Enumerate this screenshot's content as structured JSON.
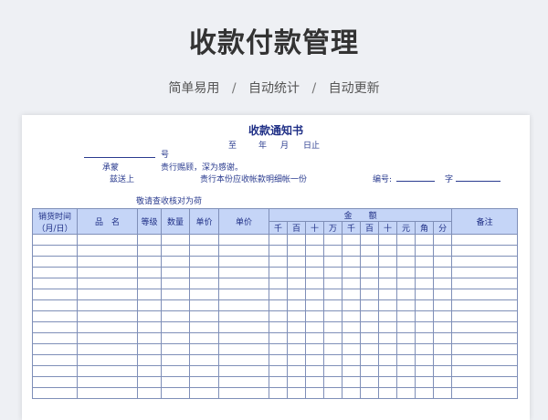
{
  "header": {
    "title": "收款付款管理",
    "features": [
      "简单易用",
      "自动统计",
      "自动更新"
    ],
    "separator": "/"
  },
  "document": {
    "title": "收款通知书",
    "date_line": {
      "to": "至",
      "year": "年",
      "month": "月",
      "day_end": "日止"
    },
    "number_suffix": "号",
    "chengmeng": "承蒙",
    "thanks": "贵行赐顾，深为感谢。",
    "zisong": "兹送上",
    "statement": "贵行本份应收帐款明细帐一份",
    "bianhao_label": "编号:",
    "zi_label": "字",
    "check_note": "敬请查收核对为荷"
  },
  "table": {
    "headers": {
      "sales_time": "销货时间",
      "sales_time_unit": "（月/日）",
      "product_name": "品　名",
      "grade": "等级",
      "quantity": "数量",
      "unit_price": "单价",
      "unit": "单价",
      "amount": "金　　额",
      "remarks": "备注"
    },
    "digit_columns": [
      "千",
      "百",
      "十",
      "万",
      "千",
      "百",
      "十",
      "元",
      "角",
      "分"
    ],
    "empty_rows": 15
  },
  "colors": {
    "header_fill": "#c5d5f7",
    "ink": "#2a3b8f",
    "grid_line": "#7f8fb8"
  }
}
